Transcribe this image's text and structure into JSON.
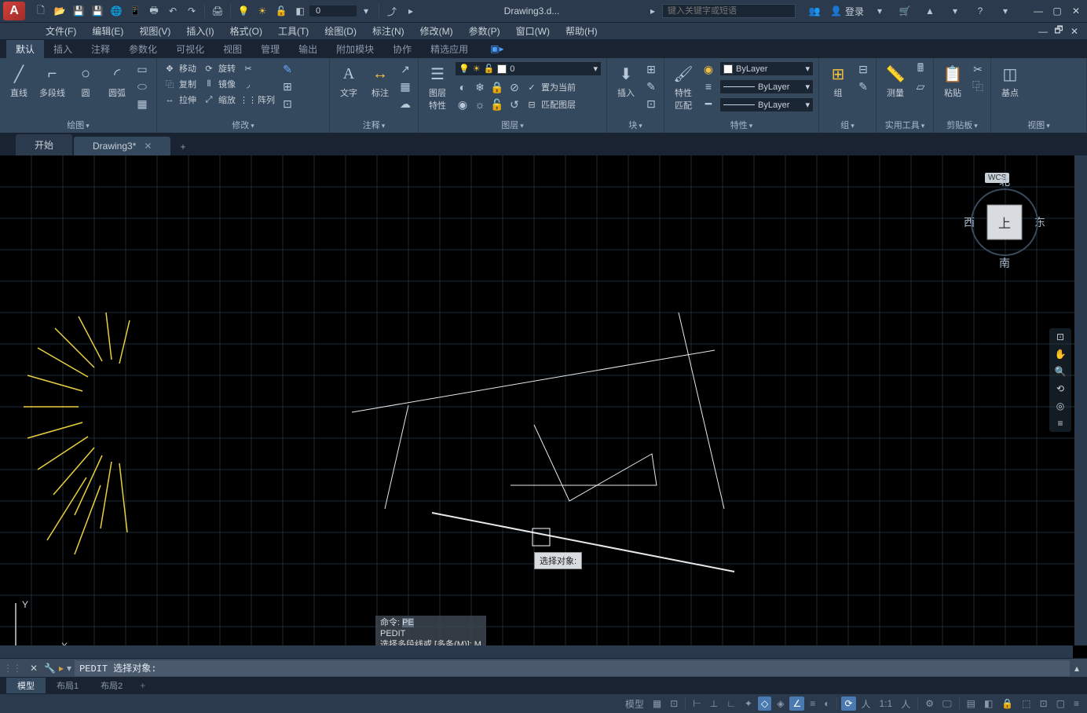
{
  "titlebar": {
    "doc_name": "Drawing3.d...",
    "search_placeholder": "键入关键字或短语",
    "login": "登录",
    "qat_value": "0"
  },
  "menu": {
    "items": [
      "文件(F)",
      "编辑(E)",
      "视图(V)",
      "插入(I)",
      "格式(O)",
      "工具(T)",
      "绘图(D)",
      "标注(N)",
      "修改(M)",
      "参数(P)",
      "窗口(W)",
      "帮助(H)"
    ]
  },
  "ribbon_tabs": [
    "默认",
    "插入",
    "注释",
    "参数化",
    "可视化",
    "视图",
    "管理",
    "输出",
    "附加模块",
    "协作",
    "精选应用"
  ],
  "ribbon_active": 0,
  "panels": {
    "draw": {
      "title": "绘图",
      "line": "直线",
      "polyline": "多段线",
      "circle": "圆",
      "arc": "圆弧"
    },
    "modify": {
      "title": "修改",
      "move": "移动",
      "rotate": "旋转",
      "copy": "复制",
      "mirror": "镜像",
      "stretch": "拉伸",
      "scale": "缩放",
      "array": "阵列"
    },
    "annotate": {
      "title": "注释",
      "text": "文字",
      "dim": "标注"
    },
    "layer": {
      "title": "图层",
      "props": "图层\n特性",
      "current": "置为当前",
      "match": "匹配图层",
      "layer_value": "0"
    },
    "block": {
      "title": "块",
      "insert": "插入"
    },
    "properties": {
      "title": "特性",
      "match": "特性\n匹配",
      "color": "ByLayer",
      "ltype": "ByLayer",
      "lweight": "ByLayer"
    },
    "group": {
      "title": "组",
      "group": "组"
    },
    "utils": {
      "title": "实用工具",
      "measure": "测量"
    },
    "clip": {
      "title": "剪贴板",
      "paste": "粘贴"
    },
    "view": {
      "title": "视图",
      "base": "基点"
    }
  },
  "doc_tabs": {
    "start": "开始",
    "current": "Drawing3*"
  },
  "viewcube": {
    "n": "北",
    "s": "南",
    "e": "东",
    "w": "西",
    "top": "上",
    "wcs": "WCS"
  },
  "tooltip": "选择对象:",
  "cmd_hist": {
    "l1a": "命令:",
    "l1b": "PE",
    "l2": "PEDIT",
    "l3": "选择多段线或 [多条(M)]: M"
  },
  "cmdline": {
    "text": "PEDIT 选择对象:"
  },
  "layout_tabs": {
    "model": "模型",
    "l1": "布局1",
    "l2": "布局2"
  },
  "status": {
    "model": "模型",
    "scale": "1:1"
  },
  "ucs": {
    "x": "X",
    "y": "Y"
  }
}
